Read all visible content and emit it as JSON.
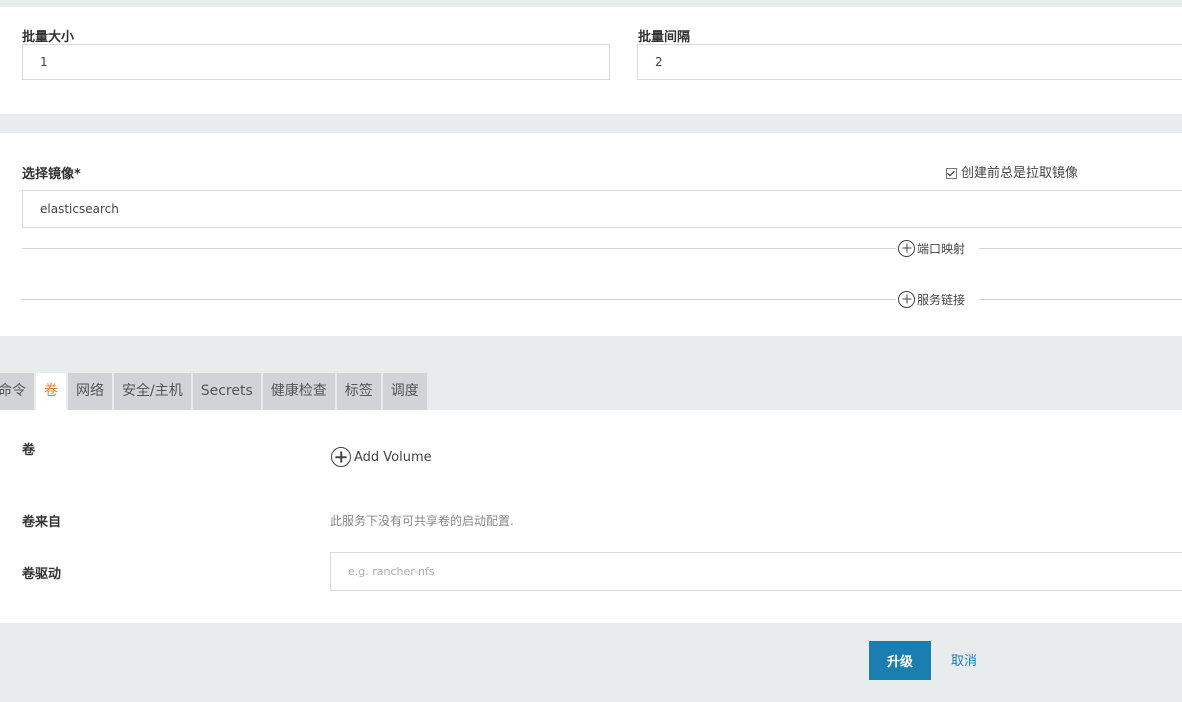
{
  "batch": {
    "size_label": "批量大小",
    "size_value": "1",
    "interval_label": "批量间隔",
    "interval_value": "2"
  },
  "image": {
    "label": "选择镜像*",
    "value": "elasticsearch",
    "always_pull_label": "创建前总是拉取镜像",
    "always_pull_checked": true,
    "port_mapping_label": "端口映射",
    "service_link_label": "服务链接"
  },
  "tabs": [
    {
      "label": "命令",
      "active": false
    },
    {
      "label": "卷",
      "active": true
    },
    {
      "label": "网络",
      "active": false
    },
    {
      "label": "安全/主机",
      "active": false
    },
    {
      "label": "Secrets",
      "active": false
    },
    {
      "label": "健康检查",
      "active": false
    },
    {
      "label": "标签",
      "active": false
    },
    {
      "label": "调度",
      "active": false
    }
  ],
  "volumes": {
    "volumes_label": "卷",
    "add_volume_label": "Add Volume",
    "volumes_from_label": "卷来自",
    "volumes_from_text": "此服务下没有可共享卷的启动配置.",
    "driver_label": "卷驱动",
    "driver_placeholder": "e.g. rancher-nfs",
    "driver_value": ""
  },
  "footer": {
    "upgrade_label": "升级",
    "cancel_label": "取消"
  },
  "colors": {
    "primary": "#1a7fb0",
    "active_tab_text": "#d7822e",
    "page_bg": "#e9eced"
  }
}
